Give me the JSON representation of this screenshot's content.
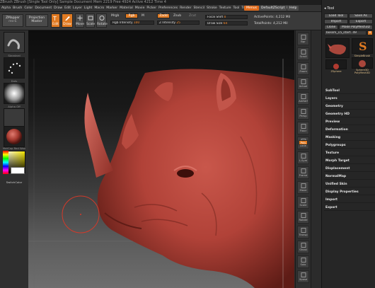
{
  "titlebar": {
    "text": "ZBrush   ZBrush [Single Tool Only]   Sample Document   Mem 2219 Free 4924 Active 4212 Time 4"
  },
  "menu": {
    "items": [
      "Alpha",
      "Brush",
      "Color",
      "Document",
      "Draw",
      "Edit",
      "Layer",
      "Light",
      "Macro",
      "Marker",
      "Material",
      "Movie",
      "Picker",
      "Preferences",
      "Render",
      "Stencil",
      "Stroke",
      "Texture",
      "Tool",
      "Transform",
      "Zoom",
      "Zplugin",
      "Zscript"
    ],
    "menus_label": "Menus",
    "script_label": "DefaultZScript",
    "help_label": "Help"
  },
  "toolbar": {
    "zmapper_label": "ZMapper",
    "zmapper_sub": "rev-E",
    "projection_label": "Projection",
    "projection_sub": "Master",
    "edit_label": "Edit",
    "draw_label": "Draw",
    "move_label": "Move",
    "scale_label": "Scale",
    "rotate_label": "Rotate",
    "mrgb_label": "Mrgb",
    "rgb_label": "Rgb",
    "m_label": "M",
    "zadd_label": "Zadd",
    "zsub_label": "Zsub",
    "zcut_label": "Zcut",
    "rgb_intensity_label": "Rgb Intensity",
    "rgb_intensity_value": "100",
    "z_intensity_label": "Z Intensity",
    "z_intensity_value": "25",
    "focal_shift_label": "Focal Shift",
    "focal_shift_value": "0",
    "draw_size_label": "Draw Size",
    "draw_size_value": "64",
    "active_points_label": "ActivePoints:",
    "active_points_value": "4,212 Mil",
    "total_points_label": "TotalPoints:",
    "total_points_value": "4,212 Mil"
  },
  "leftshelf": {
    "captions": [
      "Standard",
      "Dots",
      "Alpha Off",
      "Texture Off",
      "MatCap Red Wax"
    ],
    "switch_color_label": "SwitchColor"
  },
  "rightshelf": {
    "items": [
      "Bpr",
      "Scroll",
      "Zoom",
      "Actual",
      "AAHalf",
      "Persp",
      "Floor",
      "Local",
      "L.Sym",
      "Frame",
      "Move",
      "Scale",
      "Rotate",
      "Transp",
      "Ghost",
      "Solo",
      "Xpose"
    ],
    "badge": "Poly"
  },
  "palette": {
    "title": "Tool",
    "load_tool": "Load Tool",
    "save_as": "Save As",
    "import": "Import",
    "export": "Export",
    "clone": "Clone",
    "make_polymesh": "Make PolyMesh3D",
    "tool_name": "bossm_15_start. 49",
    "thumb_captions": [
      "SimpleBrush",
      "Sphere3D",
      "ZSphere",
      "PolyMesh3D"
    ],
    "sections": [
      "SubTool",
      "Layers",
      "Geometry",
      "Geometry HD",
      "Preview",
      "Deformation",
      "Masking",
      "Polygroups",
      "Texture",
      "Morph Target",
      "Displacement",
      "NormalMap",
      "Unified Skin",
      "Display Properties",
      "Import",
      "Export"
    ]
  },
  "colors": {
    "accent": "#e07a22",
    "clay": "#b5473d",
    "panel": "#262626"
  }
}
